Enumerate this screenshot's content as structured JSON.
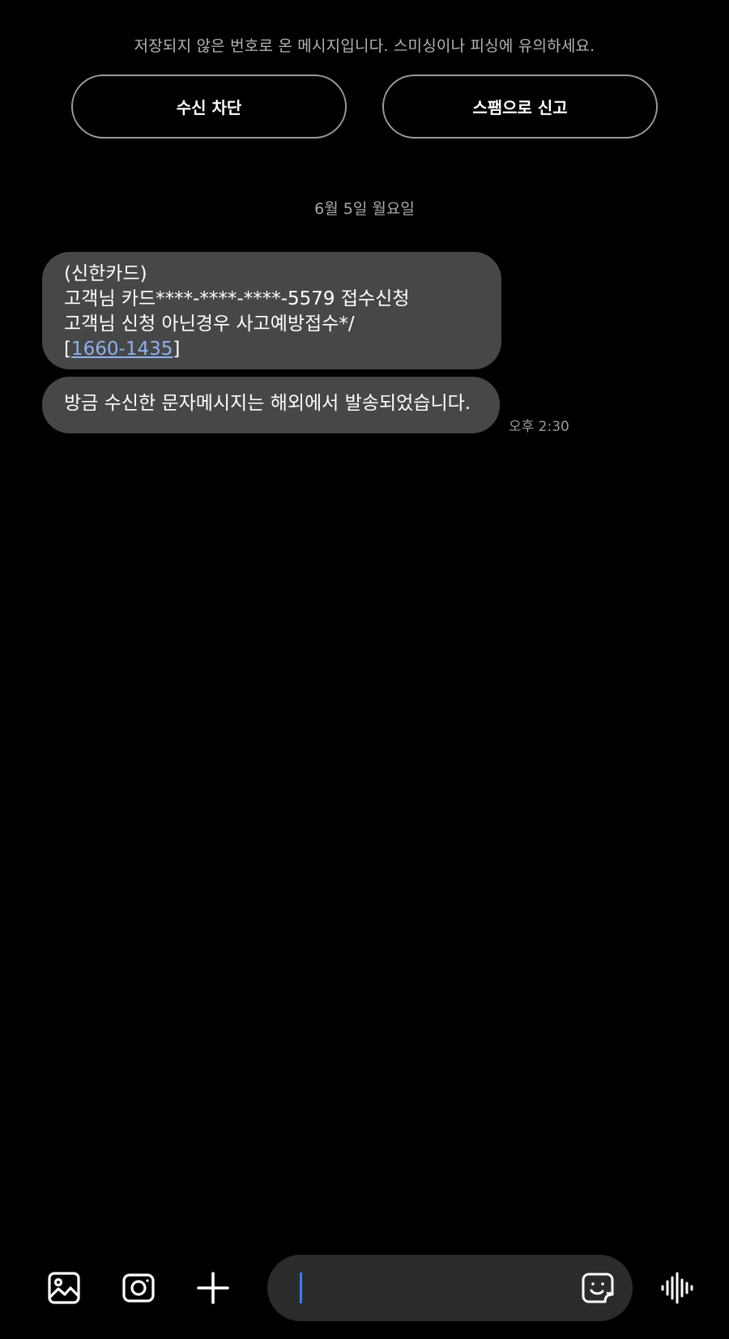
{
  "colors": {
    "background": "#000000",
    "bubble": "#474747",
    "link": "#8fb0ee",
    "cursor": "#3d7bf0",
    "input_bg": "#2b2b2b"
  },
  "header": {
    "warning_text": "저장되지 않은 번호로 온 메시지입니다. 스미싱이나 피싱에 유의하세요.",
    "block_button": "수신 차단",
    "report_spam_button": "스팸으로 신고"
  },
  "conversation": {
    "date_separator": "6월 5일 월요일",
    "messages": [
      {
        "lines": [
          "(신한카드)",
          "고객님 카드****-****-****-5579 접수신청",
          "고객님 신청 아닌경우 사고예방접수*/"
        ],
        "link_prefix": "[",
        "phone_link": "1660-1435",
        "link_suffix": "]"
      },
      {
        "text": "방금 수신한 문자메시지는 해외에서 발송되었습니다.",
        "time": "오후 2:30"
      }
    ]
  },
  "composer": {
    "input_value": "",
    "icons": {
      "gallery": "gallery-icon",
      "camera": "camera-icon",
      "attach": "plus-icon",
      "sticker": "emoji-sticker-icon",
      "voice": "voice-waveform-icon"
    }
  }
}
